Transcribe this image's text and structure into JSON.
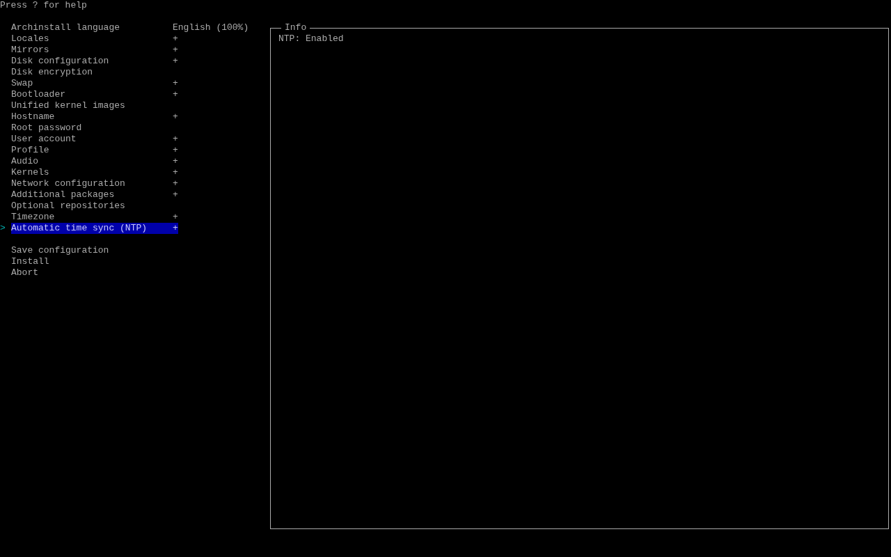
{
  "help_hint": "Press ? for help",
  "cursor": ">",
  "menu": {
    "items": [
      {
        "label": "Archinstall language",
        "value": "English (100%)",
        "selected": false
      },
      {
        "label": "Locales",
        "value": "+",
        "selected": false
      },
      {
        "label": "Mirrors",
        "value": "+",
        "selected": false
      },
      {
        "label": "Disk configuration",
        "value": "+",
        "selected": false
      },
      {
        "label": "Disk encryption",
        "selected": false
      },
      {
        "label": "Swap",
        "value": "+",
        "selected": false
      },
      {
        "label": "Bootloader",
        "value": "+",
        "selected": false
      },
      {
        "label": "Unified kernel images",
        "selected": false
      },
      {
        "label": "Hostname",
        "value": "+",
        "selected": false
      },
      {
        "label": "Root password",
        "selected": false
      },
      {
        "label": "User account",
        "value": "+",
        "selected": false
      },
      {
        "label": "Profile",
        "value": "+",
        "selected": false
      },
      {
        "label": "Audio",
        "value": "+",
        "selected": false
      },
      {
        "label": "Kernels",
        "value": "+",
        "selected": false
      },
      {
        "label": "Network configuration",
        "value": "+",
        "selected": false
      },
      {
        "label": "Additional packages",
        "value": "+",
        "selected": false
      },
      {
        "label": "Optional repositories",
        "selected": false
      },
      {
        "label": "Timezone",
        "value": "+",
        "selected": false
      },
      {
        "label": "Automatic time sync (NTP)",
        "value": "+",
        "selected": true
      }
    ],
    "actions": [
      {
        "label": "Save configuration",
        "selected": false
      },
      {
        "label": "Install",
        "selected": false
      },
      {
        "label": "Abort",
        "selected": false
      }
    ]
  },
  "info_panel": {
    "title": "Info",
    "text": "NTP: Enabled"
  }
}
